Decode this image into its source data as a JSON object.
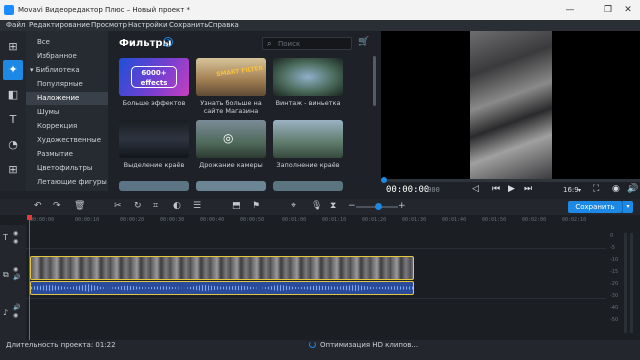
{
  "window": {
    "title": "Movavi Видеоредактор Плюс – Новый проект *",
    "controls": [
      "—",
      "❐",
      "✕"
    ]
  },
  "menu": [
    "Файл",
    "Редактирование",
    "Просмотр",
    "Настройки",
    "Сохранить",
    "Справка"
  ],
  "left_tools": [
    "import-icon",
    "filters-icon",
    "transitions-icon",
    "titles-icon",
    "stickers-icon",
    "more-tools-icon"
  ],
  "categories": {
    "items": [
      {
        "label": "Все"
      },
      {
        "label": "Избранное"
      },
      {
        "label": "Библиотека"
      },
      {
        "label": "Популярные"
      },
      {
        "label": "Наложение"
      },
      {
        "label": "Шумы"
      },
      {
        "label": "Коррекция"
      },
      {
        "label": "Художественные"
      },
      {
        "label": "Размытие"
      },
      {
        "label": "Цветофильтры"
      },
      {
        "label": "Летающие фигуры"
      }
    ],
    "selected": "Наложение"
  },
  "filters": {
    "title": "Фильтры",
    "help": "?",
    "search_placeholder": "Поиск",
    "tiles": [
      {
        "label": "Больше эффектов",
        "thumb_text": "6000+ effects"
      },
      {
        "label": "Узнать больше на сайте Магазина",
        "thumb_text": "SMART FILTER"
      },
      {
        "label": "Винтаж - виньетка",
        "thumb_text": ""
      },
      {
        "label": "Выделение краёв",
        "thumb_text": ""
      },
      {
        "label": "Дрожание камеры",
        "thumb_text": ""
      },
      {
        "label": "Заполнение краёв",
        "thumb_text": ""
      },
      {
        "label": "",
        "thumb_text": ""
      },
      {
        "label": "",
        "thumb_text": ""
      },
      {
        "label": "",
        "thumb_text": ""
      }
    ]
  },
  "preview": {
    "timecode": "00:00:00",
    "timecode_ms": ".000",
    "aspect": "16:9"
  },
  "edit_toolbar": {
    "save_label": "Сохранить"
  },
  "ruler": [
    "00:00:00",
    "00:00:10",
    "00:00:20",
    "00:00:30",
    "00:00:40",
    "00:00:50",
    "00:01:00",
    "00:01:10",
    "00:01:20",
    "00:01:30",
    "00:01:40",
    "00:01:50",
    "00:02:00",
    "00:02:10"
  ],
  "vu_labels": [
    "0",
    "-5",
    "-10",
    "-15",
    "-20",
    "-30",
    "-40",
    "-50"
  ],
  "status": {
    "duration": "Длительность проекта: 01:22",
    "optimizing": "Оптимизация HD клипов..."
  }
}
